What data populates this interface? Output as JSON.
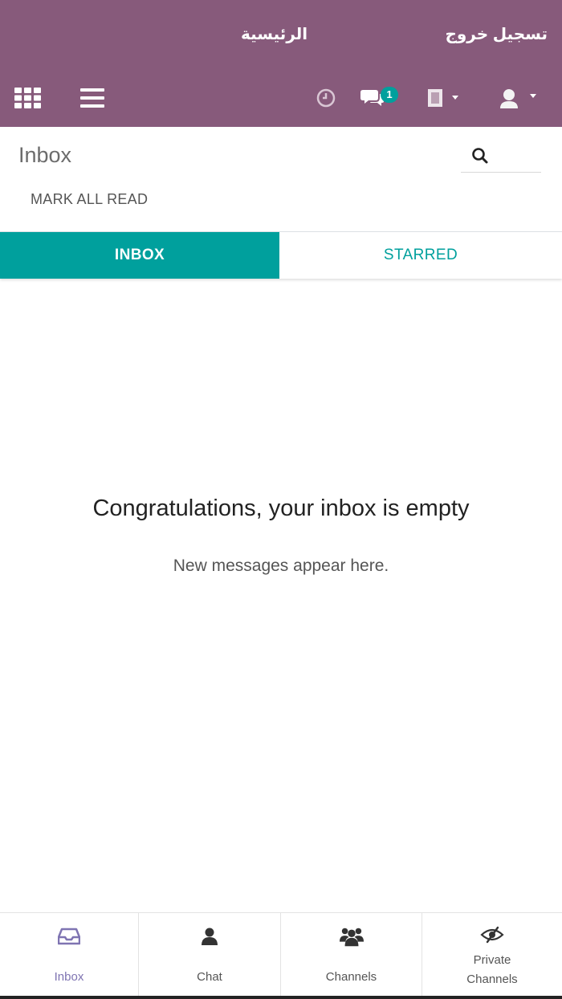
{
  "topbar": {
    "logout_label": "تسجيل خروج",
    "home_label": "الرئيسية",
    "chat_badge": "1",
    "apps_icon": "apps-grid-icon",
    "menu_icon": "hamburger-menu-icon",
    "activity_icon": "clock-icon",
    "messages_icon": "chat-bubbles-icon",
    "company_icon": "building-icon",
    "user_icon": "user-avatar-icon",
    "bar_color": "#875a7b"
  },
  "control_panel": {
    "title": "Inbox",
    "mark_all_read_label": "MARK ALL READ",
    "search_icon": "search-icon"
  },
  "tabs": [
    {
      "label": "INBOX",
      "active": true
    },
    {
      "label": "STARRED",
      "active": false
    }
  ],
  "empty_state": {
    "title": "Congratulations, your inbox is empty",
    "subtitle": "New messages appear here."
  },
  "bottom_nav": {
    "items": [
      {
        "label": "Inbox",
        "icon": "inbox-tray-icon",
        "active": true
      },
      {
        "label": "Chat",
        "icon": "user-icon",
        "active": false
      },
      {
        "label": "Channels",
        "icon": "users-group-icon",
        "active": false
      },
      {
        "label": "Private Channels",
        "icon": "eye-slash-icon",
        "active": false
      }
    ]
  },
  "colors": {
    "accent": "#00a09d",
    "brand": "#875a7b",
    "nav_active": "#7f74b2"
  }
}
